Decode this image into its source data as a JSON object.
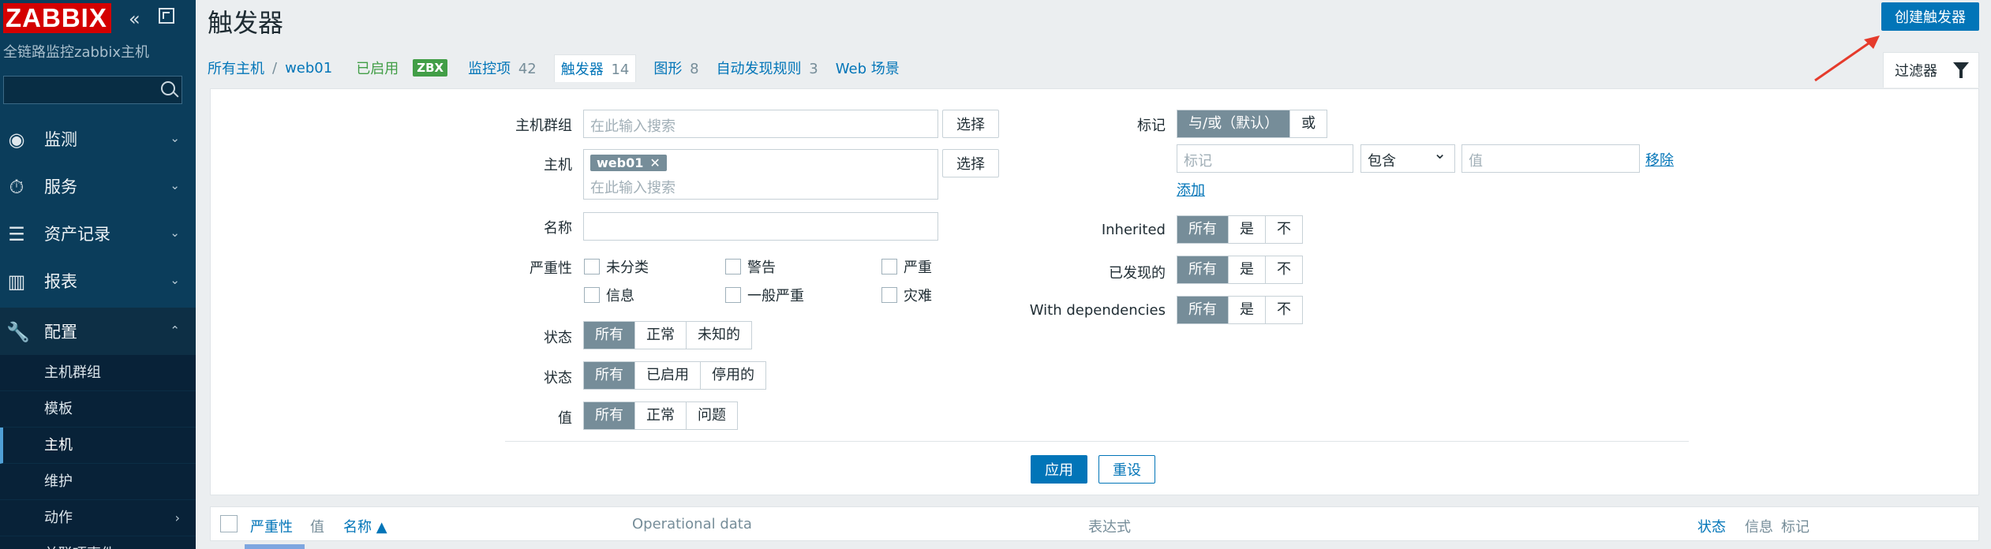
{
  "sidebar": {
    "logo": "ZABBIX",
    "server_name": "全链路监控zabbix主机",
    "collapse_icon": "«",
    "menu": [
      {
        "label": "监测",
        "icon": "eye-icon"
      },
      {
        "label": "服务",
        "icon": "clock-icon"
      },
      {
        "label": "资产记录",
        "icon": "list-icon"
      },
      {
        "label": "报表",
        "icon": "bar-chart-icon"
      },
      {
        "label": "配置",
        "icon": "wrench-icon"
      }
    ],
    "submenu": [
      "主机群组",
      "模板",
      "主机",
      "维护",
      "动作",
      "关联项事件"
    ]
  },
  "header": {
    "title": "触发器",
    "create_button": "创建触发器"
  },
  "breadcrumb": {
    "all_hosts": "所有主机",
    "separator": "/",
    "host": "web01",
    "status": "已启用",
    "zbx": "ZBX",
    "items_label": "监控项",
    "items_count": "42",
    "triggers_label": "触发器",
    "triggers_count": "14",
    "graphs_label": "图形",
    "graphs_count": "8",
    "discovery_label": "自动发现规则",
    "discovery_count": "3",
    "web_label": "Web 场景"
  },
  "filter": {
    "tab_label": "过滤器",
    "host_groups_label": "主机群组",
    "host_groups_placeholder": "在此输入搜索",
    "select_label": "选择",
    "hosts_label": "主机",
    "host_chip": "web01",
    "host_chip_remove": "✕",
    "hosts_placeholder": "在此输入搜索",
    "name_label": "名称",
    "severity_label": "严重性",
    "severities": [
      "未分类",
      "警告",
      "严重",
      "信息",
      "一般严重",
      "灾难"
    ],
    "state_label": "状态",
    "state_options": [
      "所有",
      "正常",
      "未知的"
    ],
    "status_label": "状态",
    "status_options": [
      "所有",
      "已启用",
      "停用的"
    ],
    "value_label": "值",
    "value_options": [
      "所有",
      "正常",
      "问题"
    ],
    "tags_label": "标记",
    "tags_options": [
      "与/或（默认）",
      "或"
    ],
    "tag_placeholder": "标记",
    "tag_operator": "包含",
    "tag_value_placeholder": "值",
    "remove_label": "移除",
    "add_label": "添加",
    "inherited_label": "Inherited",
    "inherited_options": [
      "所有",
      "是",
      "不"
    ],
    "discovered_label": "已发现的",
    "discovered_options": [
      "所有",
      "是",
      "不"
    ],
    "dependencies_label": "With dependencies",
    "dependencies_options": [
      "所有",
      "是",
      "不"
    ],
    "apply_label": "应用",
    "reset_label": "重设"
  },
  "table": {
    "columns": [
      "严重性",
      "值",
      "名称 ▲",
      "Operational data",
      "表达式",
      "状态",
      "信息",
      "标记"
    ]
  }
}
